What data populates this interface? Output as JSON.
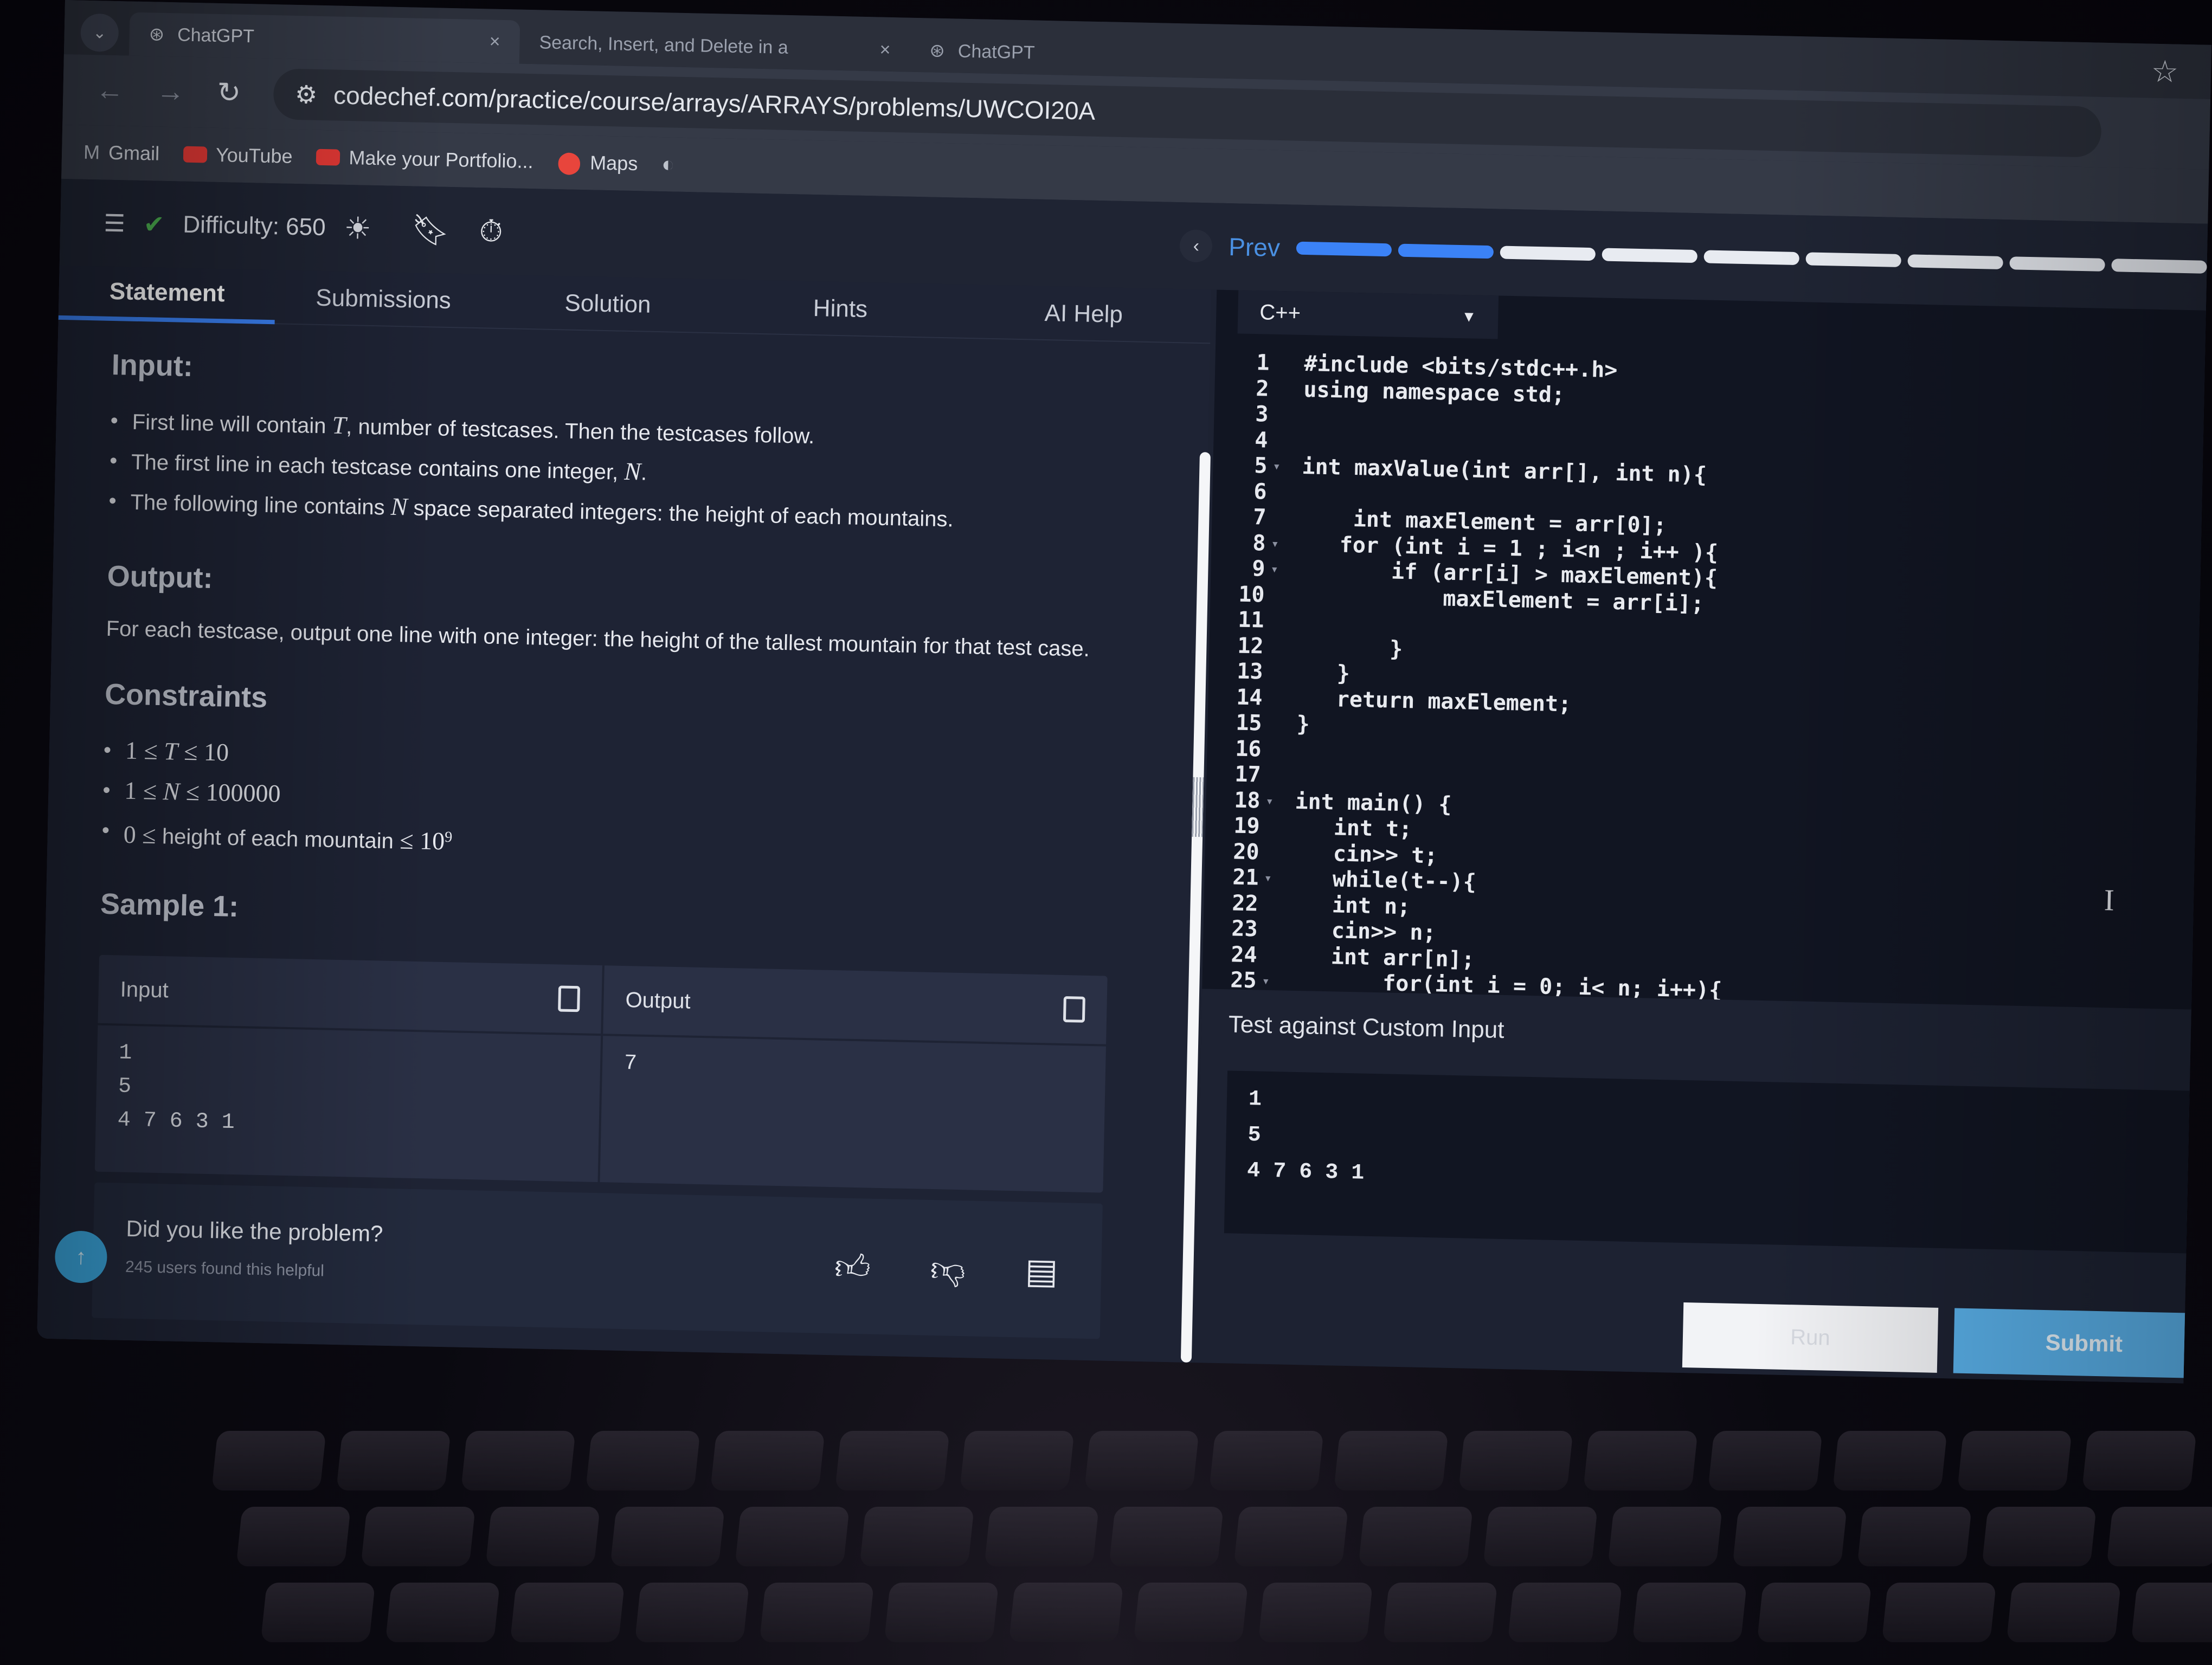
{
  "browser": {
    "tabs": [
      {
        "label": "ChatGPT",
        "close": "×"
      },
      {
        "label": "Search, Insert, and Delete in a",
        "close": "×"
      },
      {
        "label": "ChatGPT",
        "close": ""
      }
    ],
    "url": "codechef.com/practice/course/arrays/ARRAYS/problems/UWCOI20A",
    "bookmarks": [
      {
        "label": "Gmail",
        "icon": "gmail-icon"
      },
      {
        "label": "YouTube",
        "icon": "youtube-icon"
      },
      {
        "label": "Make your Portfolio...",
        "icon": "youtube-icon"
      },
      {
        "label": "Maps",
        "icon": "maps-pin-icon"
      }
    ]
  },
  "toolbar": {
    "difficulty": "Difficulty: 650",
    "prev_label": "Prev",
    "progress_total": 9,
    "progress_done": 2
  },
  "problem_tabs": [
    "Statement",
    "Submissions",
    "Solution",
    "Hints",
    "AI Help"
  ],
  "statement": {
    "input_heading": "Input:",
    "input_items": [
      [
        "First line will contain ",
        "T",
        ", number of testcases. Then the testcases follow."
      ],
      [
        "The first line in each testcase contains one integer, ",
        "N",
        "."
      ],
      [
        "The following line contains ",
        "N",
        " space separated integers: the height of each mountains."
      ]
    ],
    "output_heading": "Output:",
    "output_text": "For each testcase, output one line with one integer: the height of the tallest mountain for that test case.",
    "constraints_heading": "Constraints",
    "constraints": [
      [
        "1 ≤ ",
        "T",
        " ≤ 10"
      ],
      [
        "1 ≤ ",
        "N",
        " ≤ 100000"
      ],
      [
        "0 ≤ ",
        "height of each mountain",
        " ≤ 10",
        "9"
      ]
    ],
    "sample_heading": "Sample 1:",
    "sample": {
      "input_label": "Input",
      "output_label": "Output",
      "input_lines": [
        "1",
        "5",
        "4 7 6 3 1"
      ],
      "output_lines": [
        "7"
      ]
    },
    "feedback": {
      "question": "Did you like the problem?",
      "helpful": "245 users found this helpful"
    }
  },
  "editor": {
    "language": "C++",
    "lines": [
      "#include <bits/stdc++.h>",
      "using namespace std;",
      "",
      "",
      "int maxValue(int arr[], int n){",
      "",
      "    int maxElement = arr[0];",
      "   for (int i = 1 ; i<n ; i++ ){",
      "       if (arr[i] > maxElement){",
      "           maxElement = arr[i];",
      "",
      "       }",
      "   }",
      "   return maxElement;",
      "}",
      "",
      "",
      "int main() {",
      "   int t;",
      "   cin>> t;",
      "   while(t--){",
      "   int n;",
      "   cin>> n;",
      "   int arr[n];",
      "       for(int i = 0; i< n; i++){"
    ],
    "fold_lines": [
      5,
      8,
      9,
      18,
      21,
      25
    ]
  },
  "custom_input": {
    "title": "Test against Custom Input",
    "lines": [
      "1",
      "5",
      "4 7 6 3 1"
    ]
  },
  "actions": {
    "run_label": "Run",
    "submit_label": "Submit"
  },
  "colors": {
    "accent": "#3b82f6",
    "submit": "#5ab1ea",
    "panel": "#1e2334",
    "editor_bg": "#111522"
  }
}
